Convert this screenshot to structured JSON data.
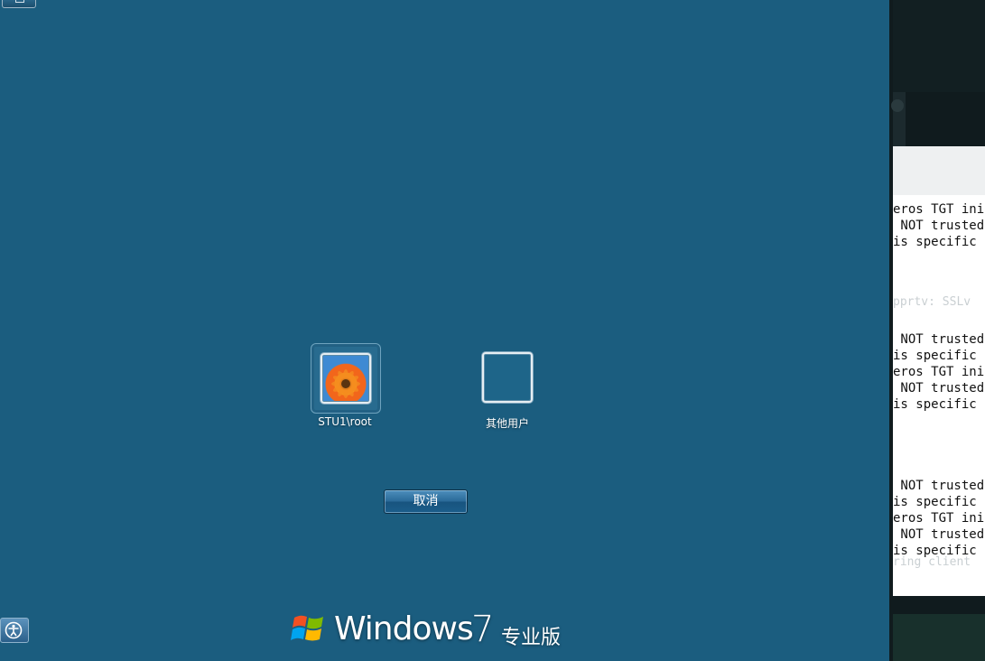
{
  "login_screen": {
    "background_color": "#1b5d7f",
    "users": [
      {
        "name": "STU1\\root",
        "avatar": "flower-avatar-icon",
        "selected": true
      },
      {
        "name": "其他用户",
        "avatar": "blank-avatar-icon",
        "selected": false
      }
    ],
    "cancel_label": "取消",
    "brand": {
      "word": "Windows",
      "version": "7",
      "edition": "专业版"
    },
    "ease_of_access_icon": "ease-of-access-icon"
  },
  "terminal": {
    "lines": [
      "eros TGT init",
      " NOT trusted",
      "is specific c",
      "pprtv: SSLv",
      " NOT trusted",
      "is specific c",
      "eros TGT init",
      " NOT trusted",
      "is specific c",
      " NOT trusted",
      "is specific c",
      "eros TGT init",
      " NOT trusted",
      "is specific c",
      "ring client"
    ]
  }
}
